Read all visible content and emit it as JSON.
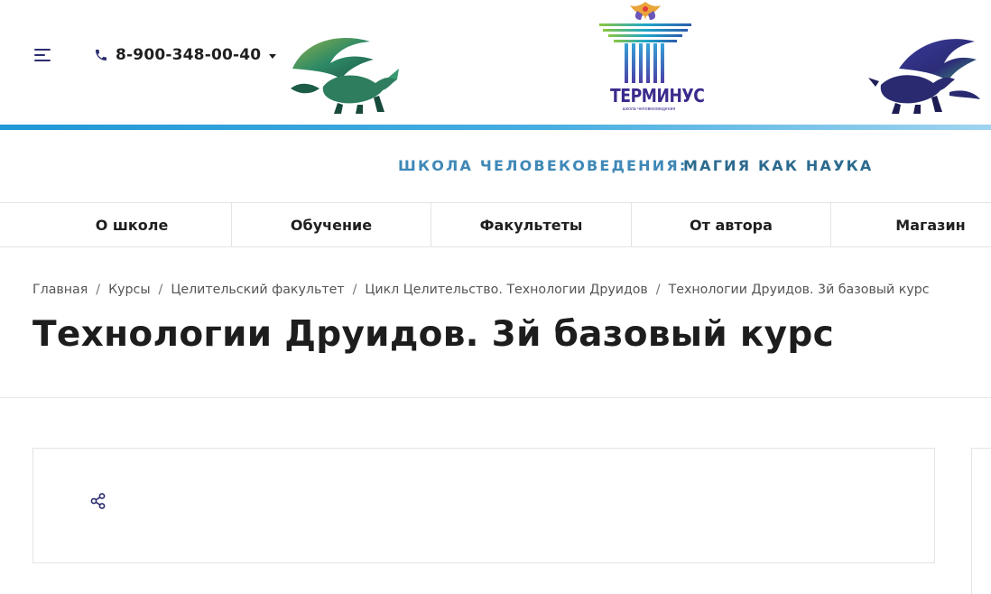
{
  "header": {
    "phone": "8-900-348-00-40",
    "logo_text": "ТЕРМИНУС",
    "logo_subtitle": "школа человековедения",
    "icons": {
      "menu": "menu-icon",
      "phone": "phone-icon",
      "caret": "chevron-down-icon",
      "share": "share-icon"
    }
  },
  "tagline": {
    "part1": "ШКОЛА ЧЕЛОВЕКОВЕДЕНИЯ:",
    "part2": "МАГИЯ КАК НАУКА"
  },
  "nav": {
    "items": [
      {
        "label": "О школе"
      },
      {
        "label": "Обучение"
      },
      {
        "label": "Факультеты"
      },
      {
        "label": "От автора"
      },
      {
        "label": "Магазин"
      }
    ]
  },
  "breadcrumbs": [
    {
      "label": "Главная"
    },
    {
      "label": "Курсы"
    },
    {
      "label": "Целительский факультет"
    },
    {
      "label": "Цикл Целительство. Технологии Друидов"
    },
    {
      "label": "Технологии Друидов. 3й базовый курс"
    }
  ],
  "page": {
    "title": "Технологии Друидов. 3й базовый курс"
  },
  "colors": {
    "accent_dark": "#2b2d6e",
    "bar_start": "#1f97d6",
    "bar_end": "#9fd4ef",
    "tagline_1": "#3f88b7",
    "tagline_2": "#2c6a8e"
  }
}
